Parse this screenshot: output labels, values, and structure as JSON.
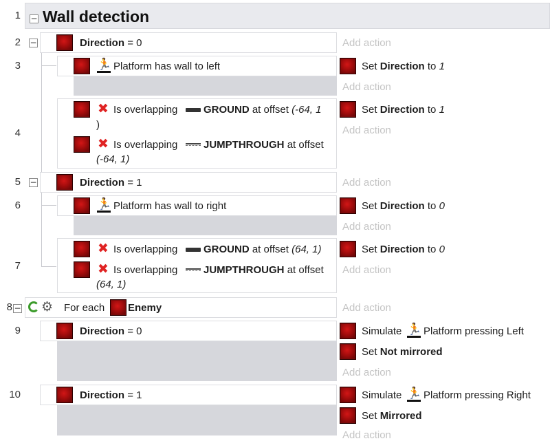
{
  "lines": [
    "1",
    "2",
    "3",
    "4",
    "5",
    "6",
    "7",
    "8",
    "9",
    "10"
  ],
  "title": "Wall detection",
  "add_action": "Add action",
  "set_word": "Set",
  "to_word": "to",
  "is_overlapping": "Is overlapping",
  "at_offset": "at offset",
  "direction_label": "Direction",
  "eq": "=",
  "zero": "0",
  "one": "1",
  "platform_wall_left": "Platform has wall to left",
  "platform_wall_right": "Platform has wall to right",
  "ground": "GROUND",
  "jumpthrough": "JUMPTHROUGH",
  "offset_left_a": "(-64, 1",
  "offset_left_b": ")",
  "offset_left_jt": "(-64, 1)",
  "offset_right": "(64, 1)",
  "for_each": "For each",
  "enemy": "Enemy",
  "simulate": "Simulate",
  "pressing_left": "Platform pressing Left",
  "pressing_right": "Platform pressing Right",
  "not_mirrored": "Not mirrored",
  "mirrored": "Mirrored",
  "icons": {
    "object": "sprite-object-icon",
    "platform": "platform-behavior-icon",
    "invert": "inverted-condition-icon",
    "ground": "tiledbg-icon",
    "jumpthrough": "jumpthru-icon",
    "repeat": "repeat-icon",
    "gear": "gear-icon"
  }
}
